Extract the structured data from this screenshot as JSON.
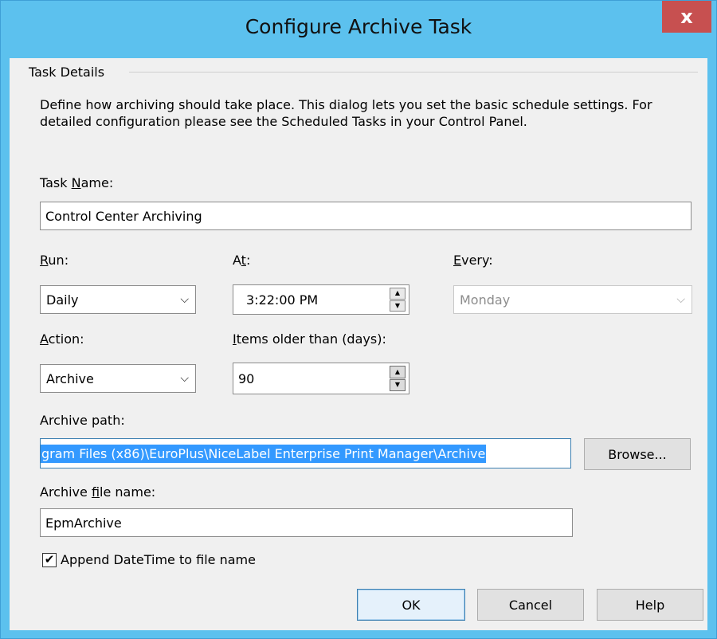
{
  "window": {
    "title": "Configure Archive Task",
    "close_glyph": "x"
  },
  "group": {
    "label": "Task Details",
    "description": "Define how archiving should take place. This dialog lets you set the basic schedule settings. For detailed configuration please see the Scheduled Tasks in your Control Panel."
  },
  "task_name": {
    "label_pre": "Task ",
    "label_access": "N",
    "label_post": "ame:",
    "value": "Control Center Archiving"
  },
  "run": {
    "label_access": "R",
    "label_post": "un:",
    "value": "Daily"
  },
  "at": {
    "label_pre": "A",
    "label_access": "t",
    "label_post": ":",
    "value": "3:22:00 PM"
  },
  "every": {
    "label_access": "E",
    "label_post": "very:",
    "value": "Monday",
    "enabled": false
  },
  "action": {
    "label_access": "A",
    "label_post": "ction:",
    "value": "Archive"
  },
  "items_older": {
    "label_access": "I",
    "label_post": "tems older than (days):",
    "value": "90"
  },
  "archive_path": {
    "label": "Archive path:",
    "value": "gram Files (x86)\\EuroPlus\\NiceLabel Enterprise Print Manager\\Archive",
    "browse_label": "Browse..."
  },
  "archive_file": {
    "label_pre": "Archive ",
    "label_access": "f",
    "label_post": "ile name:",
    "value": "EpmArchive"
  },
  "append_datetime": {
    "label": "Append DateTime to file name",
    "checked": true,
    "check_glyph": "✔"
  },
  "buttons": {
    "ok": "OK",
    "cancel": "Cancel",
    "help": "Help"
  },
  "icons": {
    "dropdown": "chevron-down-icon",
    "spin_up": "▲",
    "spin_down": "▼",
    "dropdown_glyph": "⌵"
  }
}
